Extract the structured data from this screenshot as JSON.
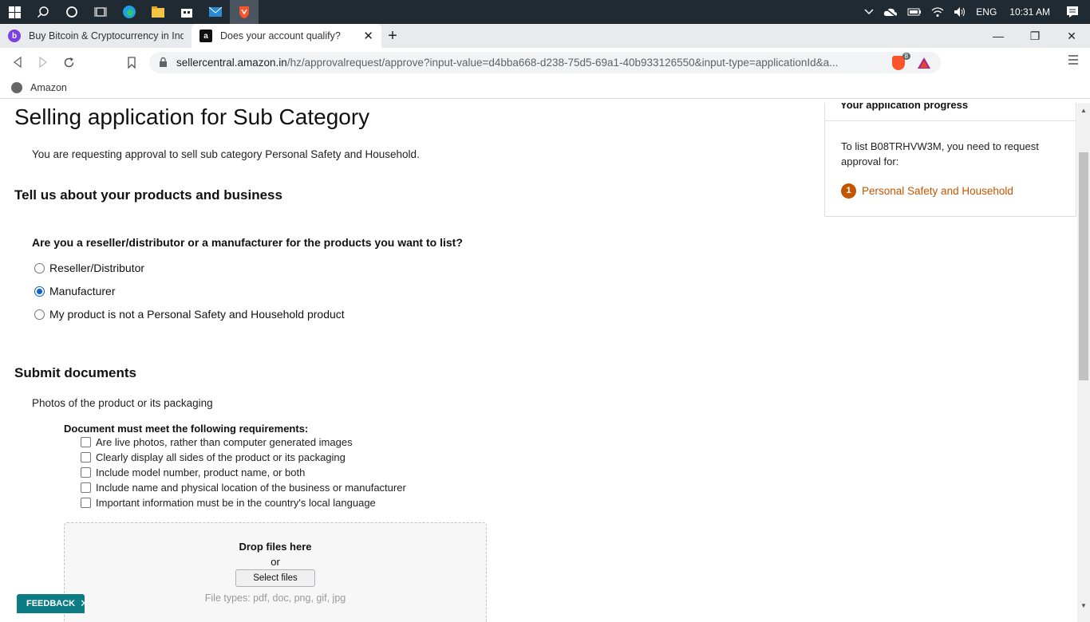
{
  "taskbar": {
    "language": "ENG",
    "time": "10:31 AM"
  },
  "tabs": [
    {
      "title": "Buy Bitcoin & Cryptocurrency in India",
      "favicon": "b"
    },
    {
      "title": "Does your account qualify?",
      "favicon": "a"
    }
  ],
  "toolbar": {
    "url_host": "sellercentral.amazon.in",
    "url_path": "/hz/approvalrequest/approve?input-value=d4bba668-d238-75d5-69a1-40b933126550&input-type=applicationId&a...",
    "shield_count": "8"
  },
  "bookmarks": [
    {
      "label": "Amazon"
    }
  ],
  "page": {
    "title": "Selling application for Sub Category",
    "intro": "You are requesting approval to sell sub category Personal Safety and Household.",
    "section1": "Tell us about your products and business",
    "question": "Are you a reseller/distributor or a manufacturer for the products you want to list?",
    "options": [
      {
        "label": "Reseller/Distributor",
        "checked": false
      },
      {
        "label": "Manufacturer",
        "checked": true
      },
      {
        "label": "My product is not a Personal Safety and Household product",
        "checked": false
      }
    ],
    "section2": "Submit documents",
    "docs_subtitle": "Photos of the product or its packaging",
    "requirements_title": "Document must meet the following requirements:",
    "requirements": [
      "Are live photos, rather than computer generated images",
      "Clearly display all sides of the product or its packaging",
      "Include model number, product name, or both",
      "Include name and physical location of the business or manufacturer",
      "Important information must be in the country's local language"
    ],
    "dropzone": {
      "title": "Drop files here",
      "or": "or",
      "button": "Select files",
      "types": "File types: pdf, doc, png, gif, jpg"
    }
  },
  "progress": {
    "header": "Your application progress",
    "text": "To list B08TRHVW3M, you need to request approval for:",
    "steps": [
      {
        "num": "1",
        "label": "Personal Safety and Household"
      }
    ]
  },
  "feedback": {
    "label": "FEEDBACK",
    "close": "✕"
  },
  "colors": {
    "accent_orange": "#c45500",
    "radio_blue": "#0b63ce",
    "feedback_teal": "#0e7c86"
  }
}
